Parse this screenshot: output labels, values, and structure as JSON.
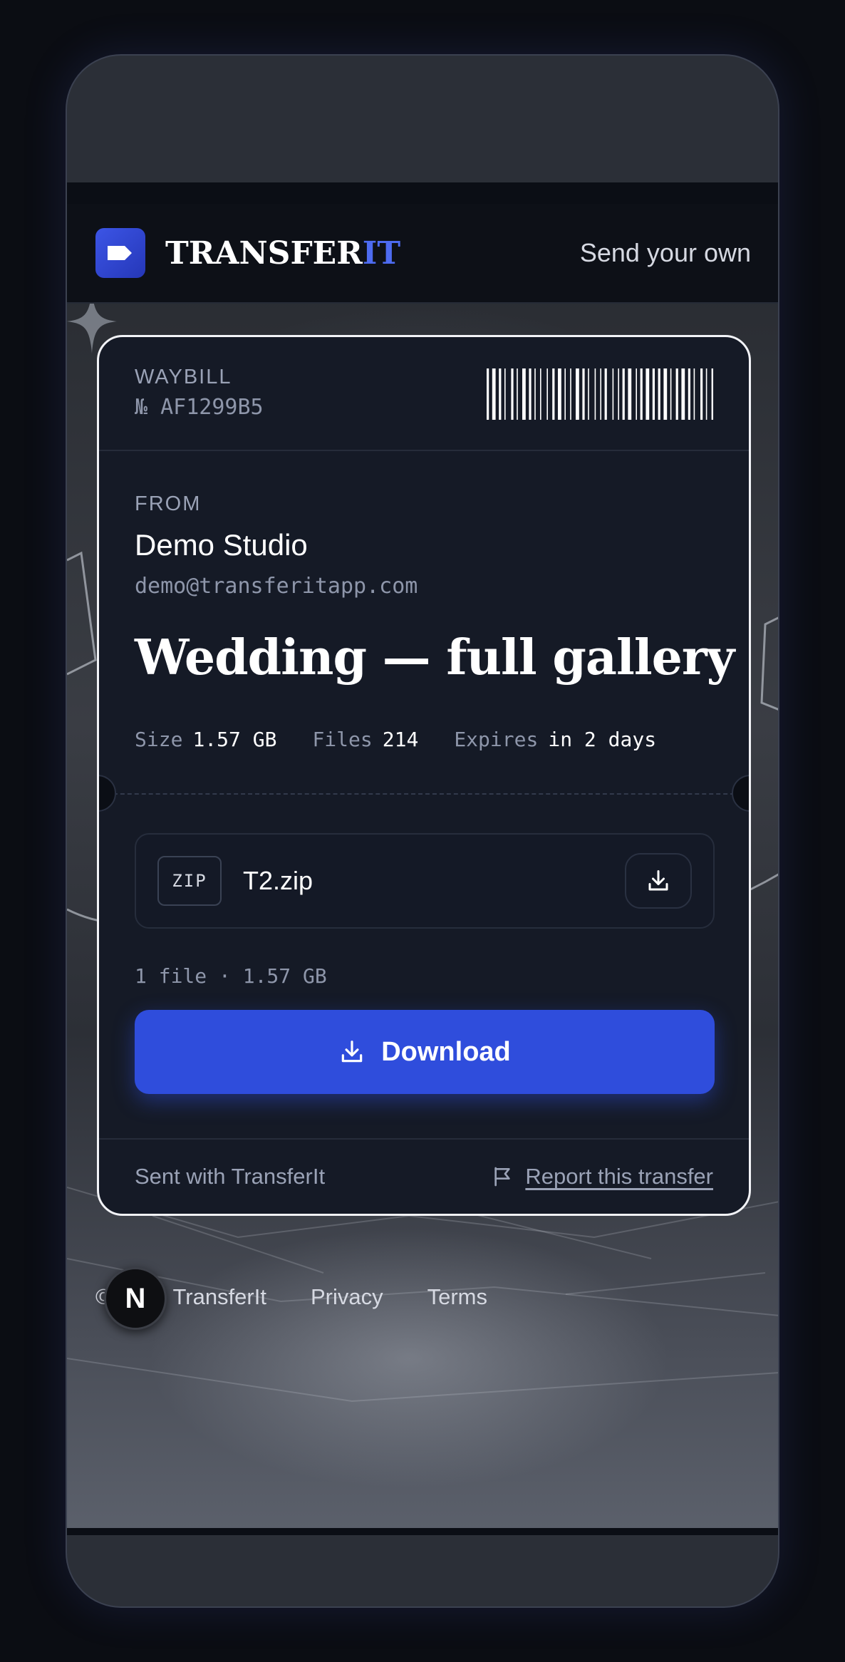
{
  "header": {
    "brand_main": "TRANSFER",
    "brand_accent": "IT",
    "send_own": "Send your own"
  },
  "waybill": {
    "label": "WAYBILL",
    "number": "№ AF1299B5"
  },
  "sender": {
    "from_label": "FROM",
    "name": "Demo Studio",
    "email": "demo@transferitapp.com"
  },
  "transfer": {
    "title": "Wedding — full gallery",
    "meta": [
      {
        "key": "Size",
        "value": "1.57 GB"
      },
      {
        "key": "Files",
        "value": "214"
      },
      {
        "key": "Expires",
        "value": "in 2 days"
      }
    ]
  },
  "file": {
    "badge": "ZIP",
    "name": "T2.zip",
    "summary": "1 file · 1.57 GB"
  },
  "actions": {
    "download_label": "Download"
  },
  "card_footer": {
    "sent_with": "Sent with TransferIt",
    "report": "Report this transfer"
  },
  "page_footer": {
    "copyright": "© 2026 TransferIt",
    "privacy": "Privacy",
    "terms": "Terms"
  },
  "badge": {
    "letter": "N"
  },
  "colors": {
    "accent": "#2f4ddc",
    "brand_accent": "#4d6bf0",
    "card_bg": "#151a26"
  }
}
